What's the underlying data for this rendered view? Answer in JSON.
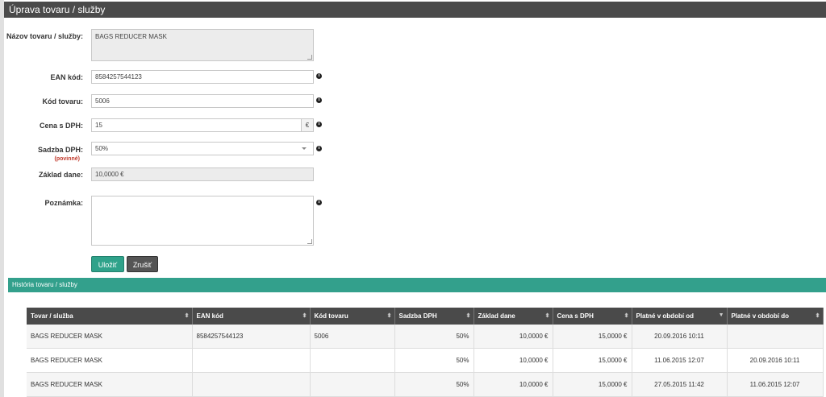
{
  "window": {
    "title": "Úprava tovaru / služby"
  },
  "form": {
    "name": {
      "label": "Názov tovaru / služby:",
      "value": "BAGS REDUCER MASK"
    },
    "ean": {
      "label": "EAN kód:",
      "value": "8584257544123"
    },
    "code": {
      "label": "Kód tovaru:",
      "value": "5006"
    },
    "price": {
      "label": "Cena s DPH:",
      "value": "15",
      "currency": "€"
    },
    "vat": {
      "label": "Sadzba DPH:",
      "required": "(povinné)",
      "value": "50%"
    },
    "base": {
      "label": "Základ dane:",
      "value": "10,0000 €"
    },
    "note": {
      "label": "Poznámka:",
      "value": ""
    },
    "info_icon": "i",
    "save_label": "Uložiť",
    "cancel_label": "Zrušiť"
  },
  "history": {
    "title": "História tovaru / služby",
    "columns": [
      "Tovar / služba",
      "EAN kód",
      "Kód tovaru",
      "Sadzba DPH",
      "Základ dane",
      "Cena s DPH",
      "Platné v období od",
      "Platné v období do"
    ],
    "rows": [
      [
        "BAGS REDUCER MASK",
        "8584257544123",
        "5006",
        "50%",
        "10,0000 €",
        "15,0000 €",
        "20.09.2016 10:11",
        ""
      ],
      [
        "BAGS REDUCER MASK",
        "",
        "",
        "50%",
        "10,0000 €",
        "15,0000 €",
        "11.06.2015 12:07",
        "20.09.2016 10:11"
      ],
      [
        "BAGS REDUCER MASK",
        "",
        "",
        "50%",
        "10,0000 €",
        "15,0000 €",
        "27.05.2015 11:42",
        "11.06.2015 12:07"
      ]
    ]
  },
  "colors": {
    "header": "#4a4a4a",
    "accent": "#33a08c",
    "save": "#2fa28a",
    "required": "#c0392b"
  }
}
